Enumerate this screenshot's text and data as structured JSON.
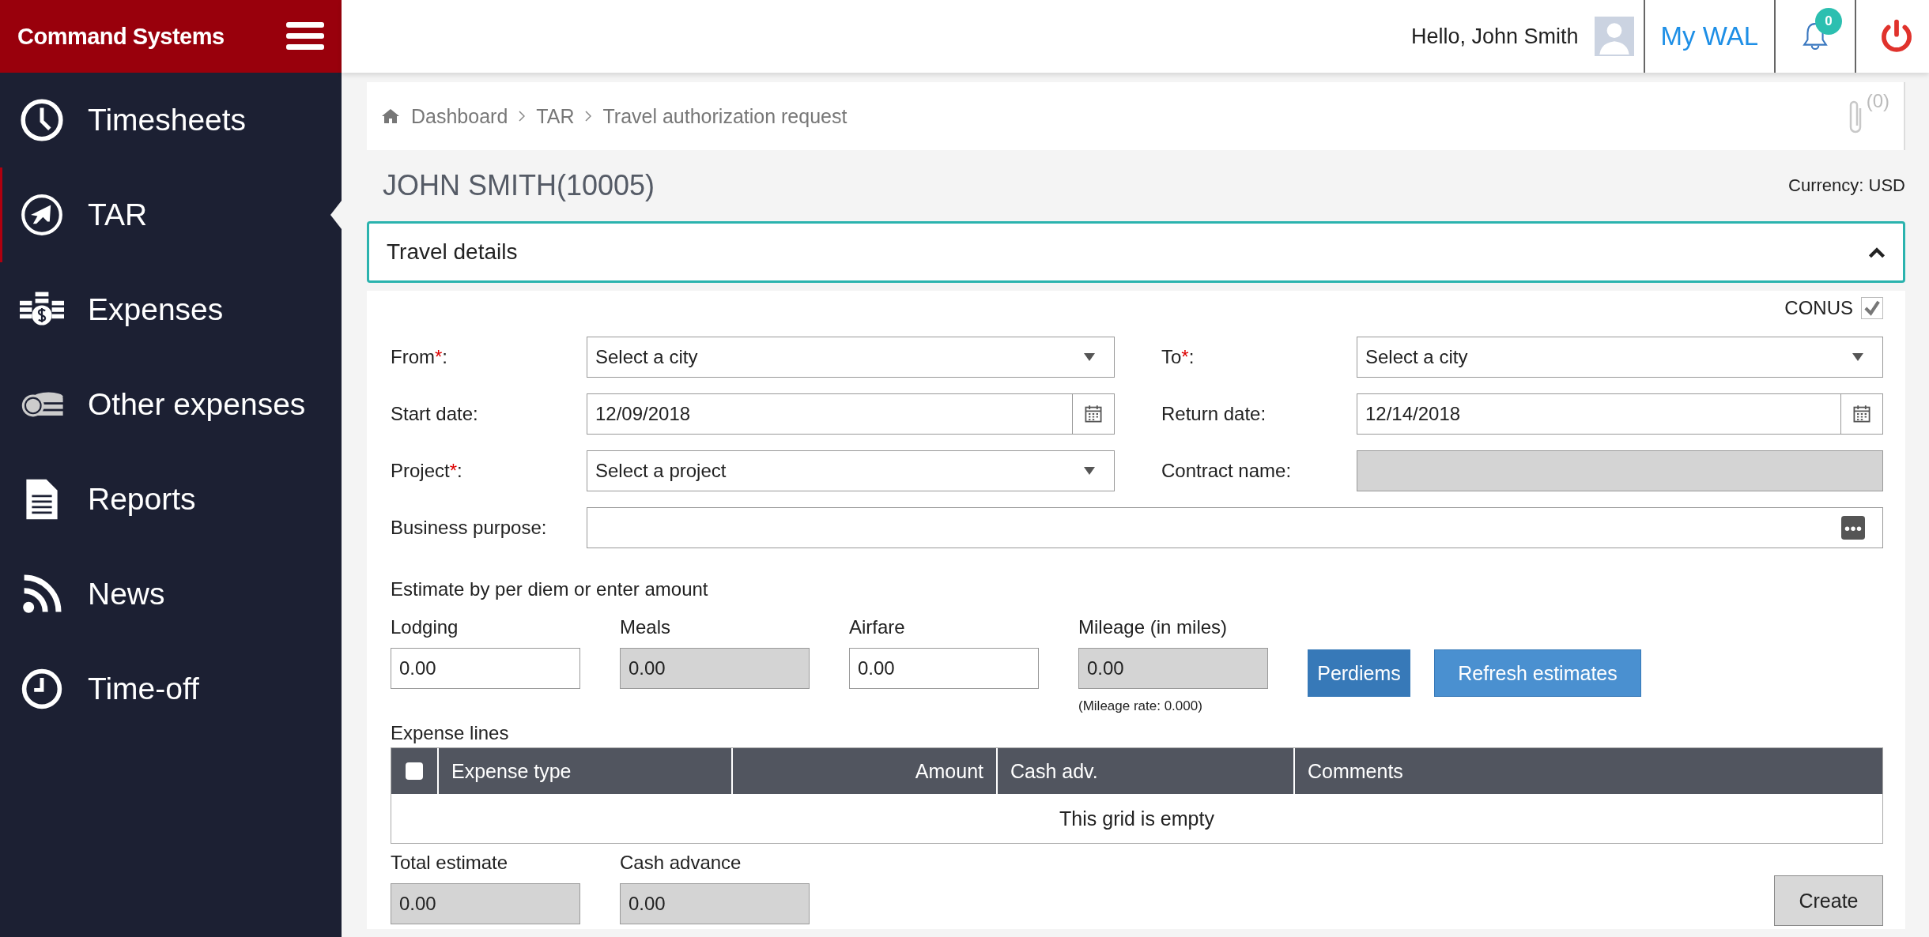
{
  "brand": "Command Systems",
  "nav": [
    {
      "label": "Timesheets",
      "selected": false
    },
    {
      "label": "TAR",
      "selected": true
    },
    {
      "label": "Expenses",
      "selected": false
    },
    {
      "label": "Other expenses",
      "selected": false
    },
    {
      "label": "Reports",
      "selected": false
    },
    {
      "label": "News",
      "selected": false
    },
    {
      "label": "Time-off",
      "selected": false
    }
  ],
  "header": {
    "greeting": "Hello, John Smith",
    "my_wal": "My WAL",
    "notifications": "0"
  },
  "breadcrumb": [
    "Dashboard",
    "TAR",
    "Travel authorization request"
  ],
  "attachments": "(0)",
  "employee": "JOHN SMITH(10005)",
  "currency": "Currency: USD",
  "section": {
    "title": "Travel details",
    "expanded": true
  },
  "conus": {
    "label": "CONUS",
    "checked": true
  },
  "fields": [
    {
      "label": "From",
      "mark": "*",
      "tail": ":",
      "kind": "select",
      "value": "Select a city"
    },
    {
      "label": "To",
      "mark": "*",
      "tail": ":",
      "kind": "select",
      "value": "Select a city"
    },
    {
      "label": "Start date:",
      "kind": "date",
      "value": "12/09/2018"
    },
    {
      "label": "Return date:",
      "kind": "date",
      "value": "12/14/2018"
    },
    {
      "label": "Project",
      "mark": "*",
      "tail": ":",
      "kind": "select",
      "value": "Select a project"
    },
    {
      "label": "Contract name:",
      "kind": "readonly"
    },
    {
      "label": "Business purpose:",
      "kind": "wide"
    }
  ],
  "estimate_heading": "Estimate by per diem or enter amount",
  "estimates": [
    {
      "label": "Lodging",
      "value": "0.00",
      "disabled": false
    },
    {
      "label": "Meals",
      "value": "0.00",
      "disabled": true
    },
    {
      "label": "Airfare",
      "value": "0.00",
      "disabled": false
    },
    {
      "label": "Mileage (in miles)",
      "value": "0.00",
      "disabled": true,
      "note": "(Mileage rate: 0.000)"
    }
  ],
  "buttons": [
    "Perdiems",
    "Refresh estimates"
  ],
  "table": {
    "title": "Expense lines",
    "select_all": false,
    "columns": [
      "Expense type",
      "Amount",
      "Cash adv.",
      "Comments"
    ],
    "empty": "This grid is empty"
  },
  "totals": [
    {
      "label": "Total estimate",
      "value": "0.00",
      "disabled": true
    },
    {
      "label": "Cash advance",
      "value": "0.00",
      "disabled": true
    }
  ],
  "create": "Create"
}
